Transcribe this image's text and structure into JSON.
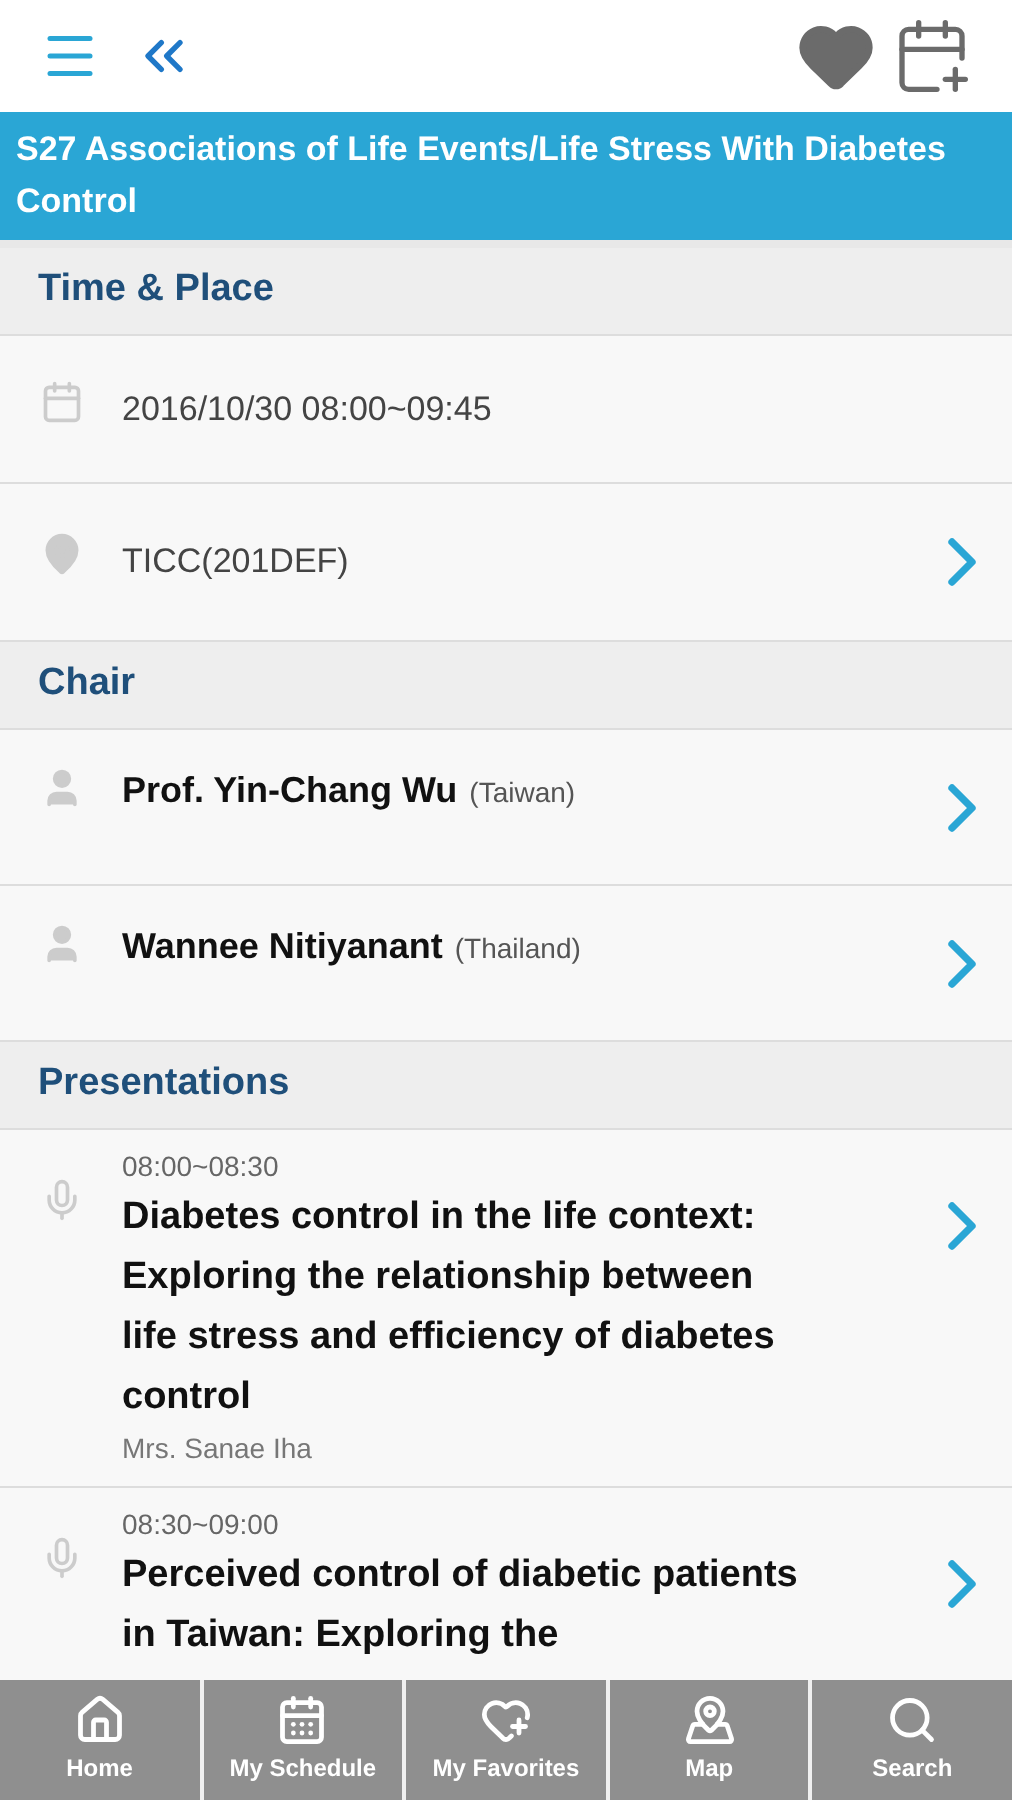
{
  "session_title": "S27 Associations of Life Events/Life Stress With Diabetes Control",
  "sections": [
    {
      "heading": "Time & Place",
      "rows": [
        {
          "kind": "date",
          "text": "2016/10/30 08:00~09:45",
          "link": false
        },
        {
          "kind": "place",
          "text": "TICC(201DEF)",
          "link": true
        }
      ]
    },
    {
      "heading": "Chair",
      "rows": [
        {
          "kind": "person",
          "name": "Prof. Yin-Chang Wu",
          "country": "(Taiwan)",
          "link": true
        },
        {
          "kind": "person",
          "name": "Wannee Nitiyanant",
          "country": "(Thailand)",
          "link": true
        }
      ]
    },
    {
      "heading": "Presentations",
      "rows": [
        {
          "kind": "talk",
          "time": "08:00~08:30",
          "title": "Diabetes control in the life context: Exploring the relationship between life stress and efficiency of diabetes control",
          "speaker": "Mrs. Sanae Iha",
          "link": true
        },
        {
          "kind": "talk",
          "time": "08:30~09:00",
          "title": "Perceived control of diabetic patients in Taiwan: Exploring the",
          "link": true
        }
      ]
    }
  ],
  "tab_bar": [
    {
      "label": "Home"
    },
    {
      "label": "My Schedule"
    },
    {
      "label": "My Favorites"
    },
    {
      "label": "Map"
    },
    {
      "label": "Search"
    }
  ]
}
